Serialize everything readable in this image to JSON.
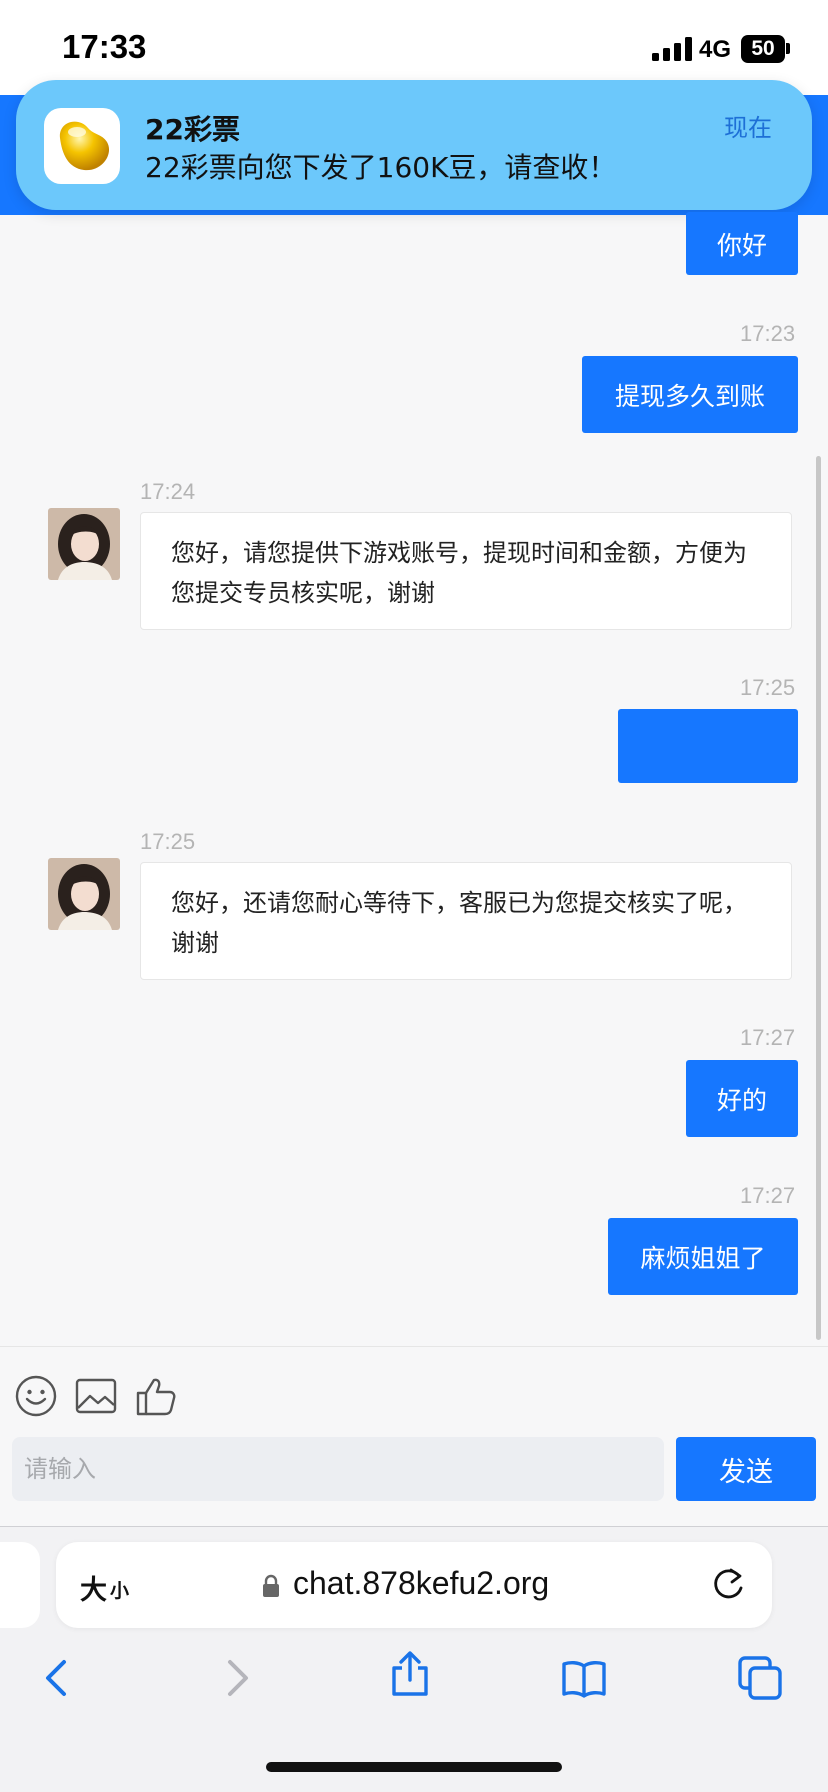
{
  "status_bar": {
    "time": "17:33",
    "network": "4G",
    "battery": "50"
  },
  "notification": {
    "app_name": "22彩票",
    "message": "22彩票向您下发了160K豆，请查收！",
    "time": "现在",
    "icon": "golden-bean-icon"
  },
  "chat": {
    "messages": [
      {
        "side": "out",
        "text": "你好"
      },
      {
        "side": "out",
        "time": "17:23",
        "text": "提现多久到账"
      },
      {
        "side": "in",
        "time": "17:24",
        "text": "您好，请您提供下游戏账号，提现时间和金额，方便为您提交专员核实呢，谢谢"
      },
      {
        "side": "out",
        "time": "17:25",
        "text": ""
      },
      {
        "side": "in",
        "time": "17:25",
        "text": "您好，还请您耐心等待下，客服已为您提交核实了呢，谢谢"
      },
      {
        "side": "out",
        "time": "17:27",
        "text": "好的"
      },
      {
        "side": "out",
        "time": "17:27",
        "text": "麻烦姐姐了"
      }
    ]
  },
  "toolbar": {
    "icons": [
      "emoji-icon",
      "image-icon",
      "thumbs-up-icon"
    ]
  },
  "composer": {
    "placeholder": "请输入",
    "send_label": "发送"
  },
  "browser": {
    "text_size_big": "大",
    "text_size_small": "小",
    "url": "chat.878kefu2.org",
    "nav_icons": [
      "back-icon",
      "forward-icon",
      "share-icon",
      "bookmarks-icon",
      "tabs-icon"
    ]
  },
  "colors": {
    "accent": "#1677ff",
    "notification_bg": "#6cc8fb",
    "chat_bg": "#f7f7f8"
  }
}
